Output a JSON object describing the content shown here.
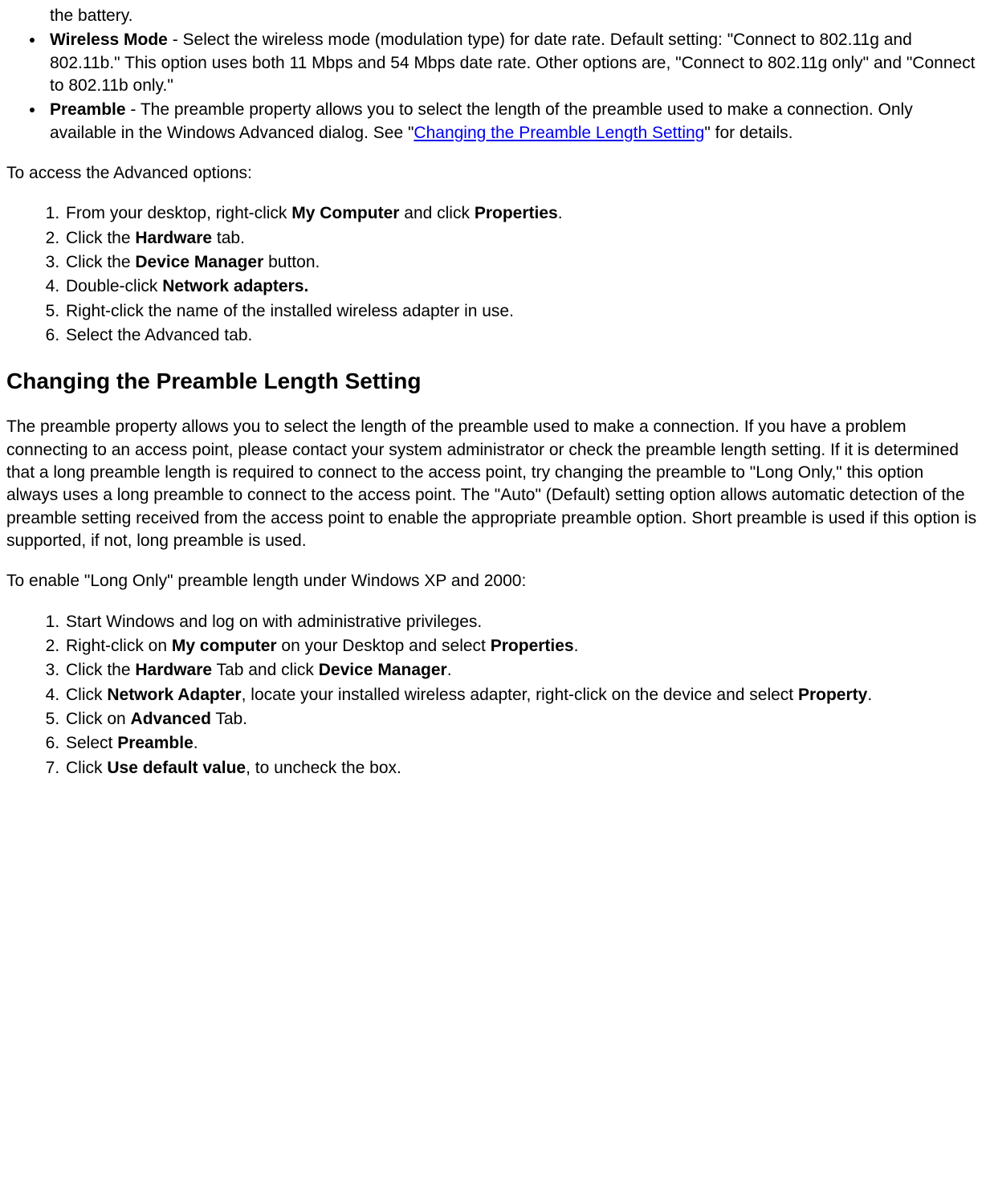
{
  "bullets": {
    "battery_frag": "the battery.",
    "wireless_label": "Wireless Mode",
    "wireless_body": " - Select the wireless mode (modulation type) for date rate. Default setting: \"Connect to 802.11g and 802.11b.\" This option uses both 11 Mbps and 54 Mbps date rate. Other options are, \"Connect to 802.11g only\" and \"Connect to 802.11b only.\"",
    "preamble_label": "Preamble",
    "preamble_body_before": " - The preamble property allows you to select the length of the preamble used to make a connection. Only available in the Windows Advanced dialog. See \"",
    "preamble_link": "Changing the Preamble Length Setting",
    "preamble_body_after": "\" for details."
  },
  "para_access": "To access the Advanced options:",
  "steps1": {
    "s1_a": "From your desktop, right-click ",
    "s1_b1": "My Computer",
    "s1_c": " and click ",
    "s1_b2": "Properties",
    "s1_d": ".",
    "s2_a": "Click the ",
    "s2_b": "Hardware",
    "s2_c": " tab.",
    "s3_a": "Click the ",
    "s3_b": "Device Manager",
    "s3_c": " button.",
    "s4_a": "Double-click ",
    "s4_b": "Network adapters.",
    "s5": "Right-click the name of the installed wireless adapter in use.",
    "s6": "Select the Advanced tab."
  },
  "heading": "Changing the Preamble Length Setting",
  "para_preamble": "The preamble property allows you to select the length of the preamble used to make a connection. If you have a problem connecting to an access point, please contact your system administrator or check the preamble length setting. If it is determined that a long preamble length is required to connect to the access point, try changing the preamble to \"Long Only,\" this option always uses a long preamble to connect to the access point. The \"Auto\" (Default) setting option allows automatic detection of the preamble setting received from the access point to enable the appropriate preamble option. Short preamble is used if this option is supported, if not, long preamble is used.",
  "para_enable": "To enable \"Long Only\" preamble length under Windows XP and 2000:",
  "steps2": {
    "s1": "Start Windows and log on with administrative privileges.",
    "s2_a": "Right-click on ",
    "s2_b1": "My computer",
    "s2_c": " on your Desktop and select ",
    "s2_b2": "Properties",
    "s2_d": ".",
    "s3_a": "Click the ",
    "s3_b1": "Hardware",
    "s3_c": " Tab and click ",
    "s3_b2": "Device Manager",
    "s3_d": ".",
    "s4_a": "Click ",
    "s4_b1": "Network Adapter",
    "s4_c": ", locate your installed wireless adapter, right-click on the device and select ",
    "s4_b2": "Property",
    "s4_d": ".",
    "s5_a": "Click on ",
    "s5_b": "Advanced",
    "s5_c": " Tab.",
    "s6_a": "Select ",
    "s6_b": "Preamble",
    "s6_c": ".",
    "s7_a": "Click ",
    "s7_b": "Use default value",
    "s7_c": ", to uncheck the box."
  }
}
